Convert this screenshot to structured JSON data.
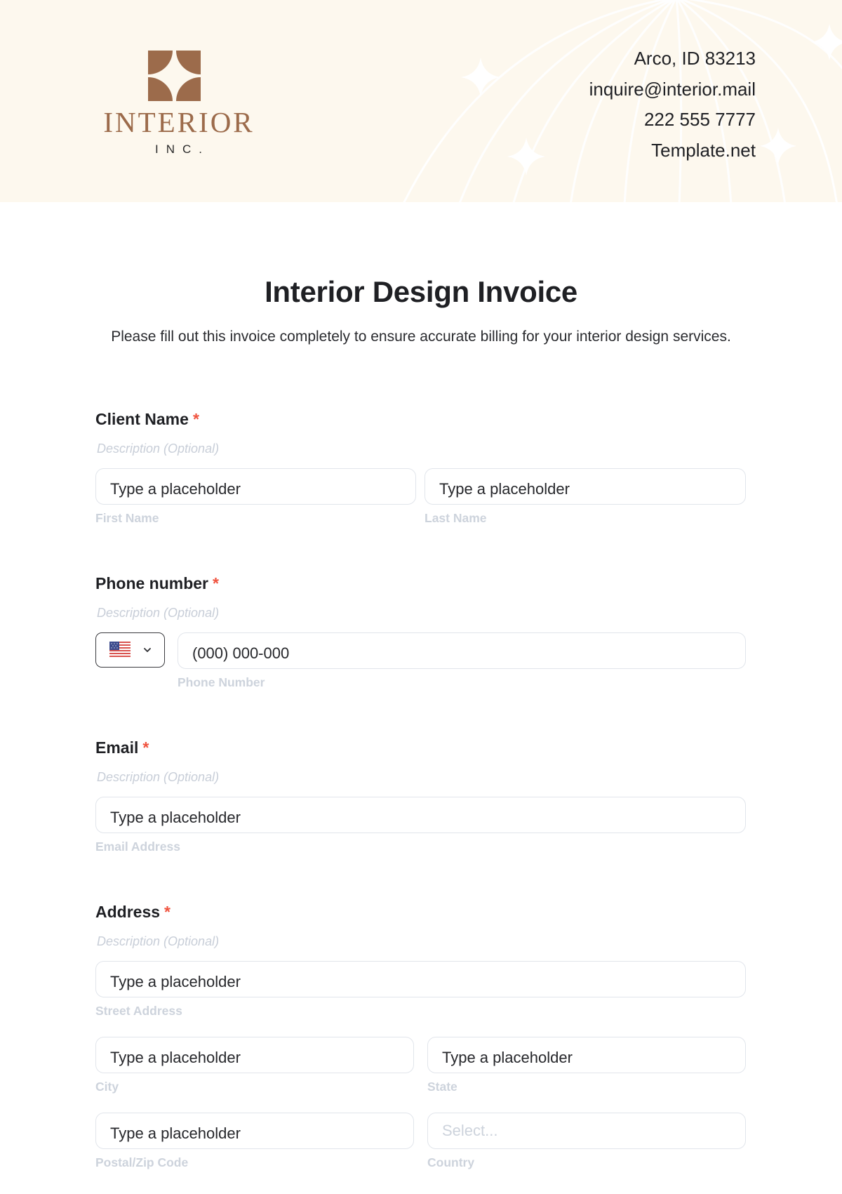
{
  "brand": {
    "name": "INTERIOR",
    "suffix": "INC.",
    "color": "#9c6b4b"
  },
  "contact": {
    "address": "Arco, ID 83213",
    "email": "inquire@interior.mail",
    "phone": "222 555 7777",
    "website": "Template.net"
  },
  "form": {
    "title": "Interior Design Invoice",
    "intro": "Please fill out this invoice completely to ensure accurate billing for your interior design services.",
    "required_marker": "*",
    "required_color": "#f0533f",
    "fields": {
      "client_name": {
        "label": "Client Name",
        "description": "Description (Optional)",
        "first": {
          "placeholder": "Type a placeholder",
          "helper": "First Name"
        },
        "last": {
          "placeholder": "Type a placeholder",
          "helper": "Last Name"
        }
      },
      "phone": {
        "label": "Phone number",
        "description": "Description (Optional)",
        "country_icon": "us-flag-icon",
        "placeholder": "(000) 000-000",
        "helper": "Phone Number"
      },
      "email": {
        "label": "Email",
        "description": "Description (Optional)",
        "placeholder": "Type a placeholder",
        "helper": "Email Address"
      },
      "address": {
        "label": "Address",
        "description": "Description (Optional)",
        "street": {
          "placeholder": "Type a placeholder",
          "helper": "Street Address"
        },
        "city": {
          "placeholder": "Type a placeholder",
          "helper": "City"
        },
        "state": {
          "placeholder": "Type a placeholder",
          "helper": "State"
        },
        "postal": {
          "placeholder": "Type a placeholder",
          "helper": "Postal/Zip Code"
        },
        "country": {
          "placeholder": "Select...",
          "helper": "Country"
        }
      }
    }
  }
}
